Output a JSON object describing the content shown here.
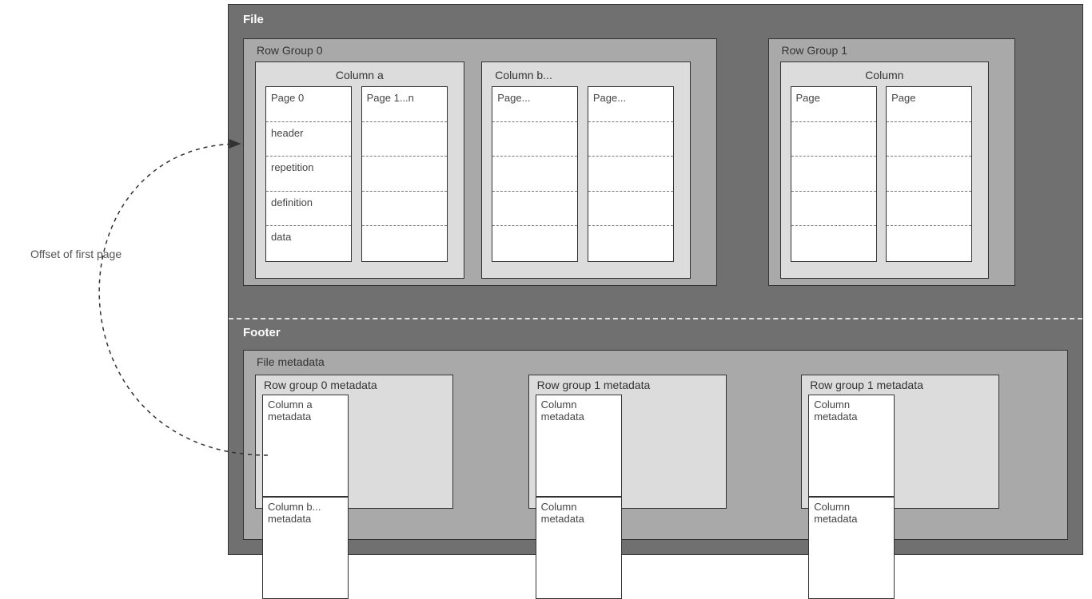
{
  "offset_label": "Offset of first page",
  "file": {
    "title": "File",
    "rowgroups": [
      {
        "label": "Row Group 0",
        "columns": [
          {
            "label": "Column a",
            "label_align": "center",
            "pages": [
              {
                "cells": [
                  "Page 0",
                  "header",
                  "repetition",
                  "definition",
                  "data"
                ]
              },
              {
                "cells": [
                  "Page 1...n",
                  "",
                  "",
                  "",
                  ""
                ]
              }
            ]
          },
          {
            "label": "Column b...",
            "label_align": "left",
            "pages": [
              {
                "cells": [
                  "Page...",
                  "",
                  "",
                  "",
                  ""
                ]
              },
              {
                "cells": [
                  "Page...",
                  "",
                  "",
                  "",
                  ""
                ]
              }
            ]
          }
        ]
      },
      {
        "label": "Row Group 1",
        "columns": [
          {
            "label": "Column",
            "label_align": "center",
            "pages": [
              {
                "cells": [
                  "Page",
                  "",
                  "",
                  "",
                  ""
                ]
              },
              {
                "cells": [
                  "Page",
                  "",
                  "",
                  "",
                  ""
                ]
              }
            ]
          }
        ]
      }
    ]
  },
  "footer": {
    "title": "Footer",
    "filemeta_label": "File metadata",
    "rowgroup_meta": [
      {
        "label": "Row group 0 metadata",
        "cols": [
          "Column a metadata",
          "Column b... metadata"
        ]
      },
      {
        "label": "Row group 1 metadata",
        "cols": [
          "Column metadata",
          "Column metadata"
        ]
      },
      {
        "label": "Row group 1 metadata",
        "cols": [
          "Column metadata",
          "Column metadata"
        ]
      }
    ]
  }
}
